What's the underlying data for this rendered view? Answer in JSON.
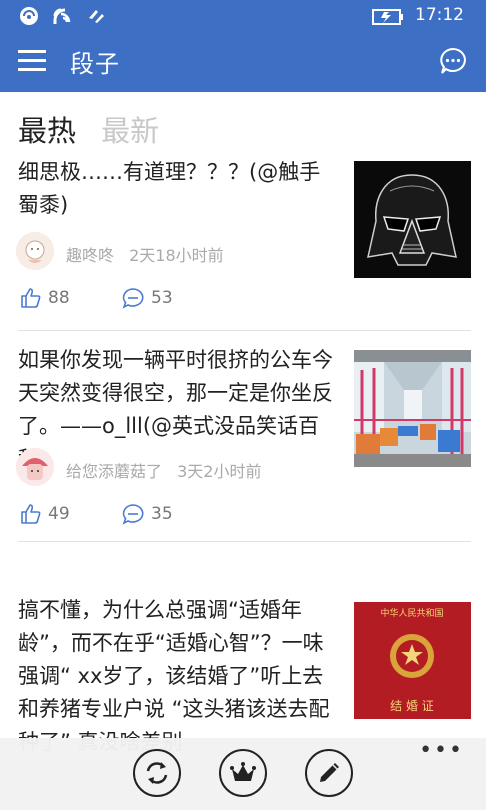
{
  "status": {
    "time": "17:12"
  },
  "app": {
    "title": "段子"
  },
  "tabs": [
    {
      "label": "最热",
      "active": true
    },
    {
      "label": "最新",
      "active": false
    }
  ],
  "posts": [
    {
      "text": "细思极……有道理？？？(@触手蜀黍)",
      "author": "趣咚咚",
      "time": "2天18小时前",
      "likes": "88",
      "comments": "53",
      "image": "darth-vader-helmet"
    },
    {
      "text": "如果你发现一辆平时很挤的公车今天突然变得很空，那一定是你坐反了。——o_lll(@英式没品笑话百科)",
      "author": "给您添蘑菇了",
      "time": "3天2小时前",
      "likes": "49",
      "comments": "35",
      "image": "empty-bus-interior"
    },
    {
      "text": "搞不懂，为什么总强调“适婚年龄”，而不在乎“适婚心智”？一味强调“ xx岁了，该结婚了”听上去和养猪专业户说 “这头猪该送去配种了” 真没啥差别",
      "author": "",
      "time": "",
      "likes": "",
      "comments": "",
      "image": "marriage-certificate",
      "image_text": {
        "top": "中华人民共和国",
        "bottom": "结 婚 证"
      }
    }
  ],
  "bottom_bar": {
    "buttons": [
      "refresh-icon",
      "crown-icon",
      "edit-pen-icon"
    ],
    "more": "•••"
  },
  "colors": {
    "accent": "#3d6fc5",
    "muted": "#aaaaaa"
  }
}
